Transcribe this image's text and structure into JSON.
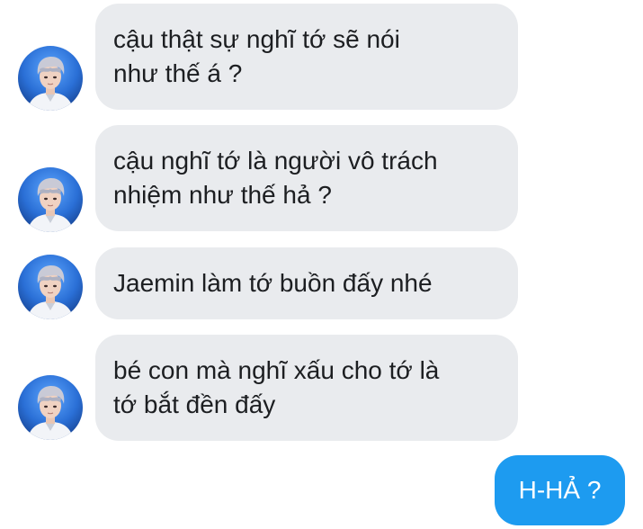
{
  "conversation": {
    "messages": [
      {
        "sender": "contact",
        "text": "cậu thật sự nghĩ tớ sẽ nói\nnhư thế á ?"
      },
      {
        "sender": "contact",
        "text": "cậu nghĩ tớ là người vô trách\nnhiệm như thế hả ?"
      },
      {
        "sender": "contact",
        "text": "Jaemin làm tớ buồn đấy nhé"
      },
      {
        "sender": "contact",
        "text": "bé con mà nghĩ xấu cho tớ là\ntớ bắt đền đấy"
      },
      {
        "sender": "me",
        "text": "H-HẢ ?"
      }
    ]
  },
  "colors": {
    "incoming_bubble": "#e9ebee",
    "outgoing_bubble": "#1d9bf0",
    "avatar_background": "#2a6fd6"
  }
}
